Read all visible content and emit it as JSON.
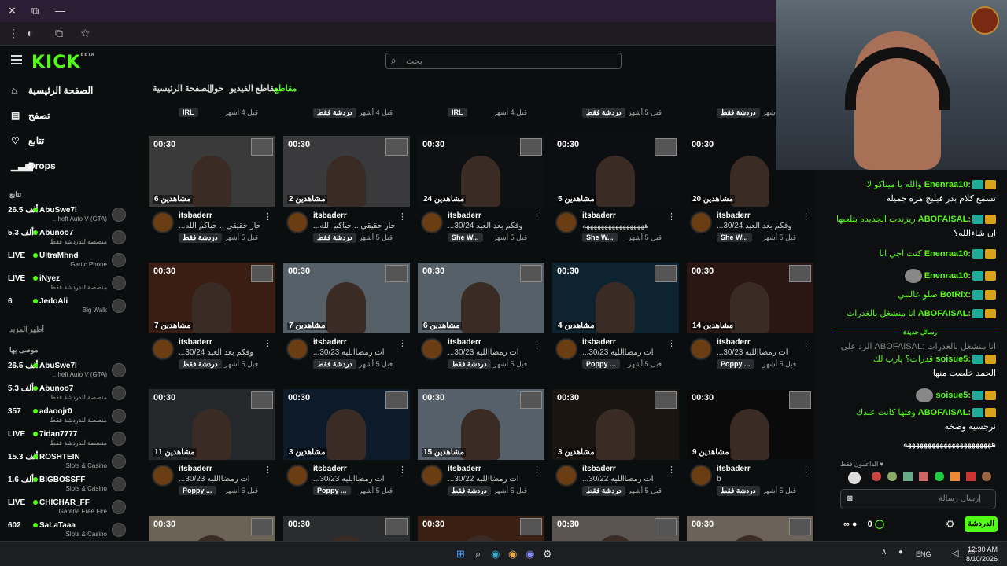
{
  "browser": {
    "tabs_icons": [
      "close-icon",
      "restore-icon",
      "minimize-icon"
    ]
  },
  "header": {
    "logo": "KICK",
    "logo_tag": "BETA",
    "search_placeholder": "بحث"
  },
  "sidebar": {
    "nav": [
      {
        "label": "الصفحة الرئيسية",
        "icon": "home-icon"
      },
      {
        "label": "تصفح",
        "icon": "browse-icon"
      },
      {
        "label": "تتابع",
        "icon": "heart-icon"
      },
      {
        "label": "Drops",
        "icon": "drops-icon"
      }
    ],
    "following_label": "تتابع",
    "following": [
      {
        "count": "26.5 ألف",
        "name": "AbuSwe7l",
        "category": "...heft Auto V (GTA)"
      },
      {
        "count": "5.3 ألف",
        "name": "Abunoo7",
        "category": "منصصة للدردشة فقط"
      },
      {
        "count": "LIVE",
        "name": "UltraMhnd",
        "category": "Gartic Phone"
      },
      {
        "count": "LIVE",
        "name": "iNyez",
        "category": "منصصة للدردشة فقط"
      },
      {
        "count": "6",
        "name": "JedoAli",
        "category": "Big Walk"
      }
    ],
    "show_more": "أظهر المزيد",
    "recommended_label": "موصى بها",
    "recommended": [
      {
        "count": "26.5 ألف",
        "name": "AbuSwe7l",
        "category": "...heft Auto V (GTA)"
      },
      {
        "count": "5.3 ألف",
        "name": "Abunoo7",
        "category": "منصصة للدردشة فقط"
      },
      {
        "count": "357",
        "name": "adaoojr0",
        "category": "منصصة للدردشة فقط"
      },
      {
        "count": "LIVE",
        "name": "7idan7777",
        "category": "منصصة للدردشة فقط"
      },
      {
        "count": "15.3 ألف",
        "name": "ROSHTEIN",
        "category": "Slots & Casino"
      },
      {
        "count": "1.6 ألف",
        "name": "BIGBOSSFF",
        "category": "Slots & Casino"
      },
      {
        "count": "LIVE",
        "name": "CHICHAR_FF",
        "category": "Garena Free Fire"
      },
      {
        "count": "602",
        "name": "SaLaTaaa",
        "category": "Slots & Casino"
      }
    ]
  },
  "tabs": [
    {
      "label": "مقاطع",
      "active": true
    },
    {
      "label": "مقاطع الفيديو",
      "active": false
    },
    {
      "label": "حول",
      "active": false
    },
    {
      "label": "الصفحة الرئيسية",
      "active": false
    }
  ],
  "top_row": [
    {
      "badge": "IRL",
      "age": "قبل 4 أشهر"
    },
    {
      "badge": "دردشة فقط",
      "age": "قبل 4 أشهر"
    },
    {
      "badge": "IRL",
      "age": "قبل 4 أشهر"
    },
    {
      "badge": "دردشة فقط",
      "age": "قبل 5 أشهر"
    },
    {
      "badge": "دردشة فقط",
      "age": "قبل 5 أشهر"
    }
  ],
  "clips": [
    {
      "dur": "00:30",
      "views": "6 مشاهدين",
      "name": "itsbaderr",
      "title": "...حار حقيقي .. حياكم الله",
      "badge": "دردشة فقط",
      "age": "قبل 5 أشهر",
      "bg": "#3b3a3a"
    },
    {
      "dur": "00:30",
      "views": "2 مشاهدين",
      "name": "itsbaderr",
      "title": "...حار حقيقي .. حياكم الله",
      "badge": "دردشة فقط",
      "age": "قبل 5 أشهر",
      "bg": "#3a3a3c"
    },
    {
      "dur": "00:30",
      "views": "24 مشاهدين",
      "name": "itsbaderr",
      "title": "...وفكم بعد العيد 30/24",
      "badge": "She W...",
      "age": "قبل 5 أشهر",
      "bg": "#0f1012"
    },
    {
      "dur": "00:30",
      "views": "5 مشاهدين",
      "name": "itsbaderr",
      "title": "هههههههههههههههههه",
      "badge": "She W...",
      "age": "قبل 5 أشهر",
      "bg": "#0d0e12"
    },
    {
      "dur": "00:30",
      "views": "20 مشاهدين",
      "name": "itsbaderr",
      "title": "...وفكم بعد العيد 30/24",
      "badge": "She W...",
      "age": "قبل 5 أشهر",
      "bg": "#0c0d0f"
    },
    {
      "dur": "00:30",
      "views": "7 مشاهدين",
      "name": "itsbaderr",
      "title": "...وفكم بعد العيد 30/24",
      "badge": "دردشة فقط",
      "age": "قبل 5 أشهر",
      "bg": "#3a1e14"
    },
    {
      "dur": "00:30",
      "views": "7 مشاهدين",
      "name": "itsbaderr",
      "title": "...ات رمضاالليه 30/23",
      "badge": "دردشة فقط",
      "age": "قبل 5 أشهر",
      "bg": "#566069"
    },
    {
      "dur": "00:30",
      "views": "6 مشاهدين",
      "name": "itsbaderr",
      "title": "...ات رمضاالليه 30/23",
      "badge": "دردشة فقط",
      "age": "قبل 5 أشهر",
      "bg": "#566069"
    },
    {
      "dur": "00:30",
      "views": "4 مشاهدين",
      "name": "itsbaderr",
      "title": "...ات رمضاالليه 30/23",
      "badge": "Poppy ...",
      "age": "قبل 5 أشهر",
      "bg": "#0e2330"
    },
    {
      "dur": "00:30",
      "views": "14 مشاهدين",
      "name": "itsbaderr",
      "title": "...ات رمضاالليه 30/23",
      "badge": "Poppy ...",
      "age": "قبل 5 أشهر",
      "bg": "#2a1612"
    },
    {
      "dur": "00:30",
      "views": "11 مشاهدين",
      "name": "itsbaderr",
      "title": "...ات رمضاالليه 30/23",
      "badge": "Poppy ...",
      "age": "قبل 5 أشهر",
      "bg": "#24282a"
    },
    {
      "dur": "00:30",
      "views": "3 مشاهدين",
      "name": "itsbaderr",
      "title": "...ات رمضاالليه 30/23",
      "badge": "Poppy ...",
      "age": "قبل 5 أشهر",
      "bg": "#0c1a2a"
    },
    {
      "dur": "00:30",
      "views": "15 مشاهدين",
      "name": "itsbaderr",
      "title": "...ات رمضاالليه 30/22",
      "badge": "دردشة فقط",
      "age": "قبل 5 أشهر",
      "bg": "#56606a"
    },
    {
      "dur": "00:30",
      "views": "3 مشاهدين",
      "name": "itsbaderr",
      "title": "...ات رمضاالليه 30/22",
      "badge": "دردشة فقط",
      "age": "قبل 5 أشهر",
      "bg": "#1a1511"
    },
    {
      "dur": "00:30",
      "views": "9 مشاهدين",
      "name": "itsbaderr",
      "title": "b",
      "badge": "دردشة فقط",
      "age": "قبل 5 أشهر",
      "bg": "#0a0a0b"
    },
    {
      "dur": "00:30",
      "views": "",
      "name": "",
      "title": "",
      "badge": "",
      "age": "",
      "bg": "#6b6356"
    },
    {
      "dur": "00:30",
      "views": "",
      "name": "",
      "title": "",
      "badge": "",
      "age": "",
      "bg": "#2a2c2e"
    },
    {
      "dur": "00:30",
      "views": "",
      "name": "",
      "title": "",
      "badge": "",
      "age": "",
      "bg": "#3a2013"
    },
    {
      "dur": "00:30",
      "views": "",
      "name": "",
      "title": "",
      "badge": "",
      "age": "",
      "bg": "#5a5550"
    },
    {
      "dur": "00:30",
      "views": "",
      "name": "",
      "title": "",
      "badge": "",
      "age": "",
      "bg": "#6a6258"
    }
  ],
  "chat": {
    "messages": [
      {
        "user": "Enenraa10:",
        "text": "والله يا ميناكو لا",
        "color": "#53fc18"
      },
      {
        "user": "",
        "text": "تسمع كلام بدر فيليج مره جميله",
        "color": "#fff"
      },
      {
        "user": "ABOFAISAL:",
        "text": "ريزندت الجديده بتلعبها",
        "color": "#53fc18"
      },
      {
        "user": "",
        "text": "ان شاءالله؟",
        "color": "#fff"
      },
      {
        "user": "Enenraa10:",
        "text": "كنت اجي انا",
        "color": "#53fc18"
      },
      {
        "user": "Enenraa10:",
        "text": "",
        "color": "#53fc18"
      },
      {
        "user": "BotRix:",
        "text": "صلو عالنبي",
        "color": "#53fc18"
      },
      {
        "user": "ABOFAISAL:",
        "text": "انا منشغل بالغدرات",
        "color": "#53fc18"
      },
      {
        "user": "",
        "text": "الرد على ABOFAISAL: انا منشغل بالغدرات",
        "color": "#888"
      },
      {
        "user": "soisue5:",
        "text": "قدرات؟ يارب لك",
        "color": "#53fc18"
      },
      {
        "user": "",
        "text": "الحمد خلصت منها",
        "color": "#fff"
      },
      {
        "user": "soisue5:",
        "text": "",
        "color": "#53fc18"
      },
      {
        "user": "ABOFAISAL:",
        "text": "وقتها كانت عندك",
        "color": "#53fc18"
      },
      {
        "user": "",
        "text": "نرجسيه وصخه",
        "color": "#fff"
      },
      {
        "user": "",
        "text": "ههههههههههههههههههههههه",
        "color": "#fff"
      }
    ],
    "new_messages": "رسائل جديدة",
    "supporters_label": "الداعمون فقط",
    "input_placeholder": "إرسال رسالة",
    "points": "0",
    "send_label": "الدردشة"
  },
  "taskbar": {
    "lang": "ENG",
    "time": "12:30 AM",
    "date": "8/10/2026"
  }
}
